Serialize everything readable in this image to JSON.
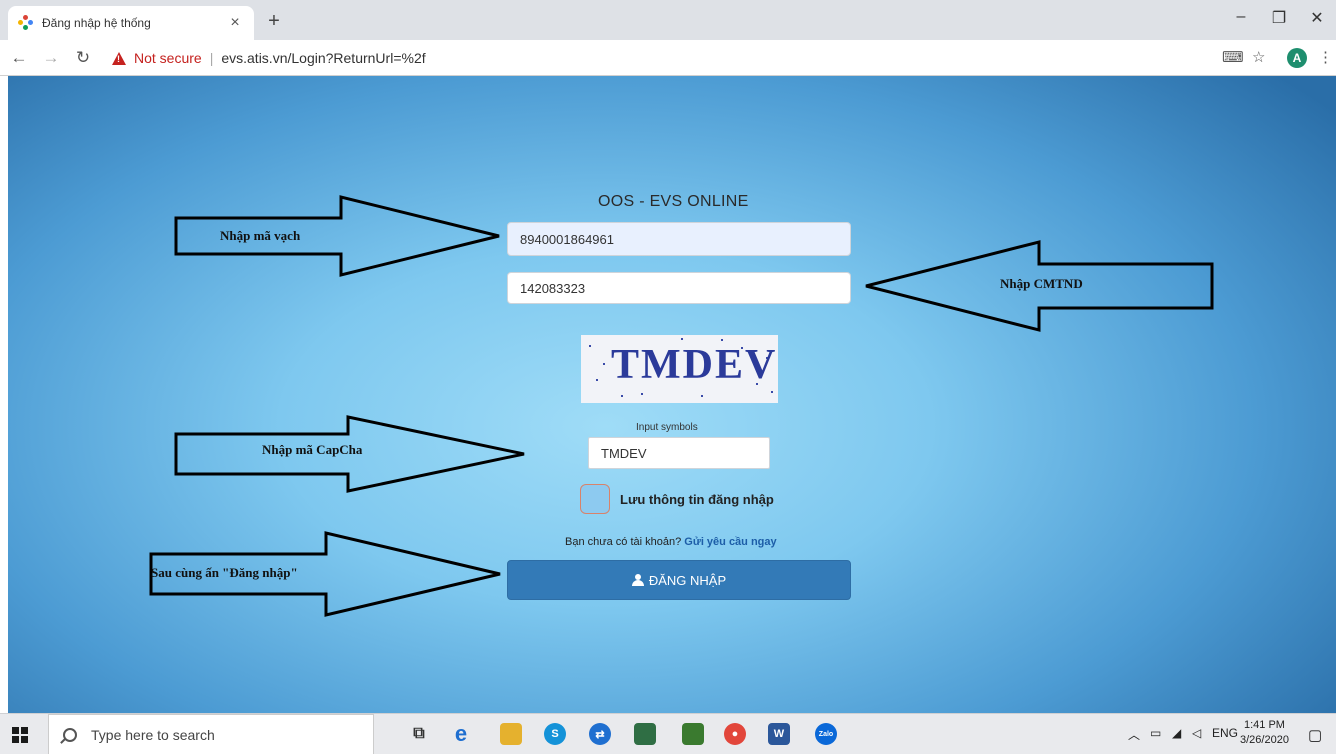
{
  "browser": {
    "tab_title": "Đăng nhập hệ thống",
    "tab_close": "×",
    "new_tab": "+",
    "not_secure": "Not secure",
    "url": "evs.atis.vn/Login?ReturnUrl=%2f",
    "avatar_letter": "A"
  },
  "login": {
    "site_title": "OOS - EVS ONLINE",
    "barcode_value": "8940001864961",
    "id_value": "142083323",
    "captcha_text": "TMDEV",
    "input_symbols_label": "Input symbols",
    "captcha_value": "TMDEV",
    "remember_label": "Lưu thông tin đăng nhập",
    "register_prompt": "Bạn chưa có tài khoản?",
    "register_link": "Gửi yêu cầu ngay",
    "login_button": "ĐĂNG NHẬP"
  },
  "annotations": {
    "barcode": "Nhập mã vạch",
    "cmnd": "Nhập CMTND",
    "captcha": "Nhập mã CapCha",
    "login": "Sau cùng ấn \"Đăng nhập\""
  },
  "taskbar": {
    "search_placeholder": "Type here to search",
    "language": "ENG",
    "time": "1:41 PM",
    "date": "3/26/2020",
    "icons": [
      "task-view-icon",
      "edge-icon",
      "file-explorer-icon",
      "skype-icon",
      "teamviewer-icon",
      "app-icon",
      "photos-icon",
      "chrome-icon",
      "word-icon",
      "zalo-icon"
    ]
  },
  "colors": {
    "login_button": "#337ab7",
    "not_secure": "#c5221f",
    "link": "#1d5ea8"
  }
}
